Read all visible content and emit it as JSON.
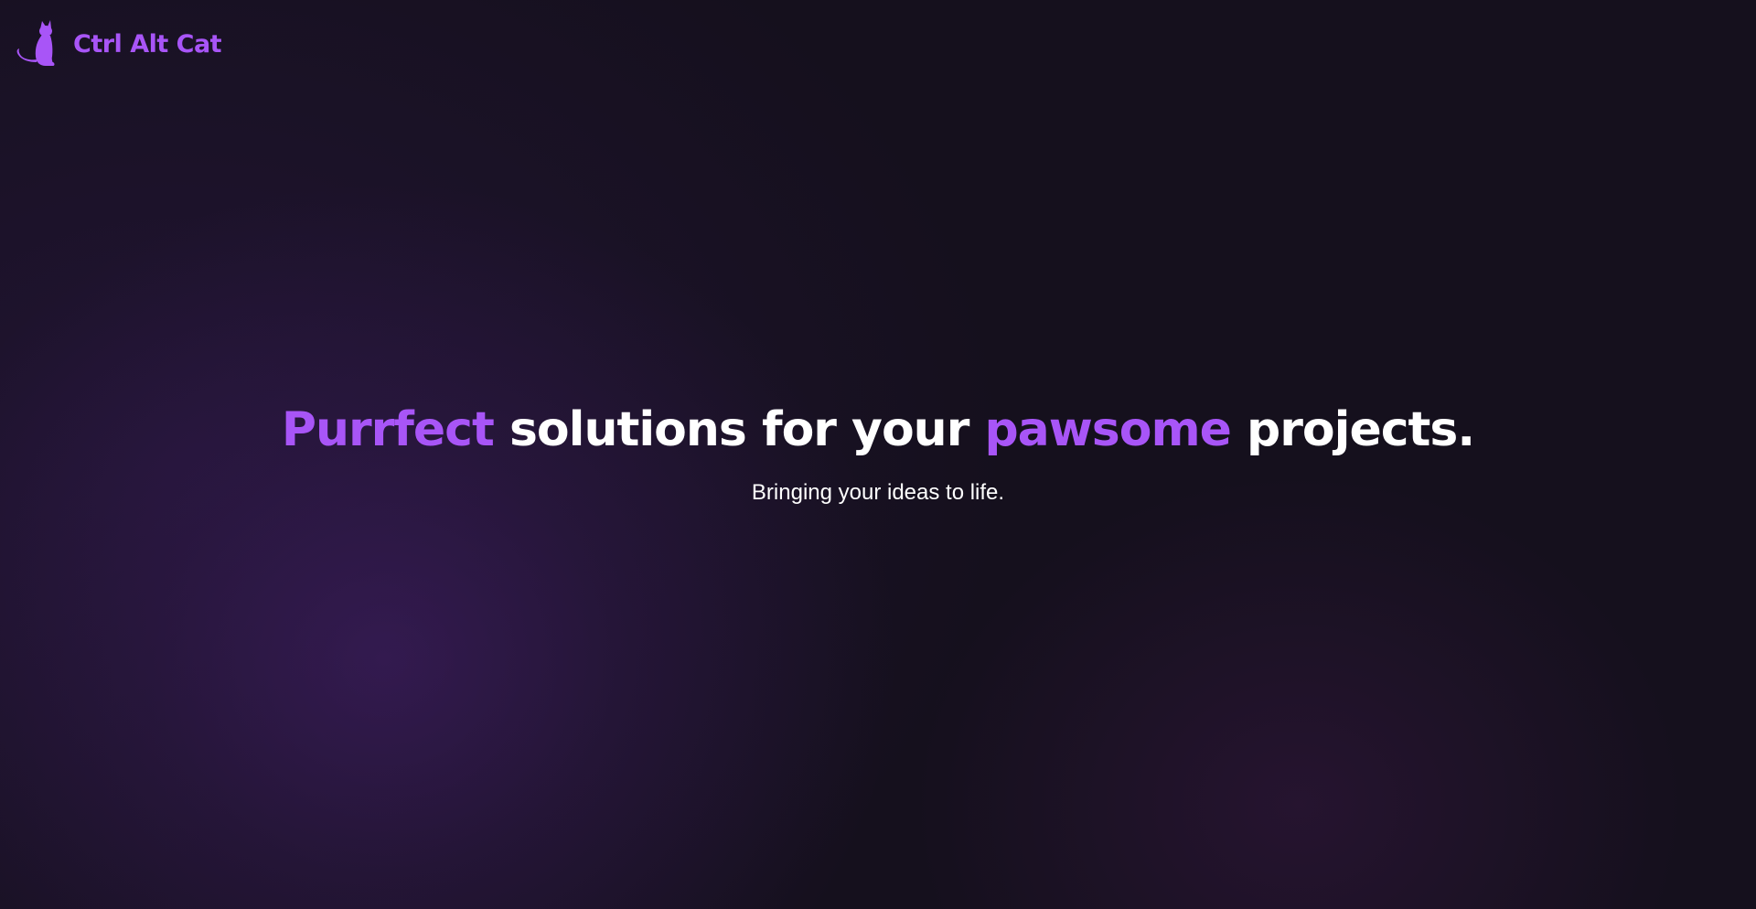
{
  "brand": {
    "name": "Ctrl Alt Cat",
    "logo_icon": "cat-silhouette-icon",
    "color": "#a855f7"
  },
  "hero": {
    "headline": {
      "accent1": "Purrfect",
      "part1": " solutions for your ",
      "accent2": "pawsome",
      "part2": " projects."
    },
    "subheadline": "Bringing your ideas to life."
  },
  "colors": {
    "accent": "#a855f7",
    "background": "#15101d",
    "text": "#ffffff"
  }
}
